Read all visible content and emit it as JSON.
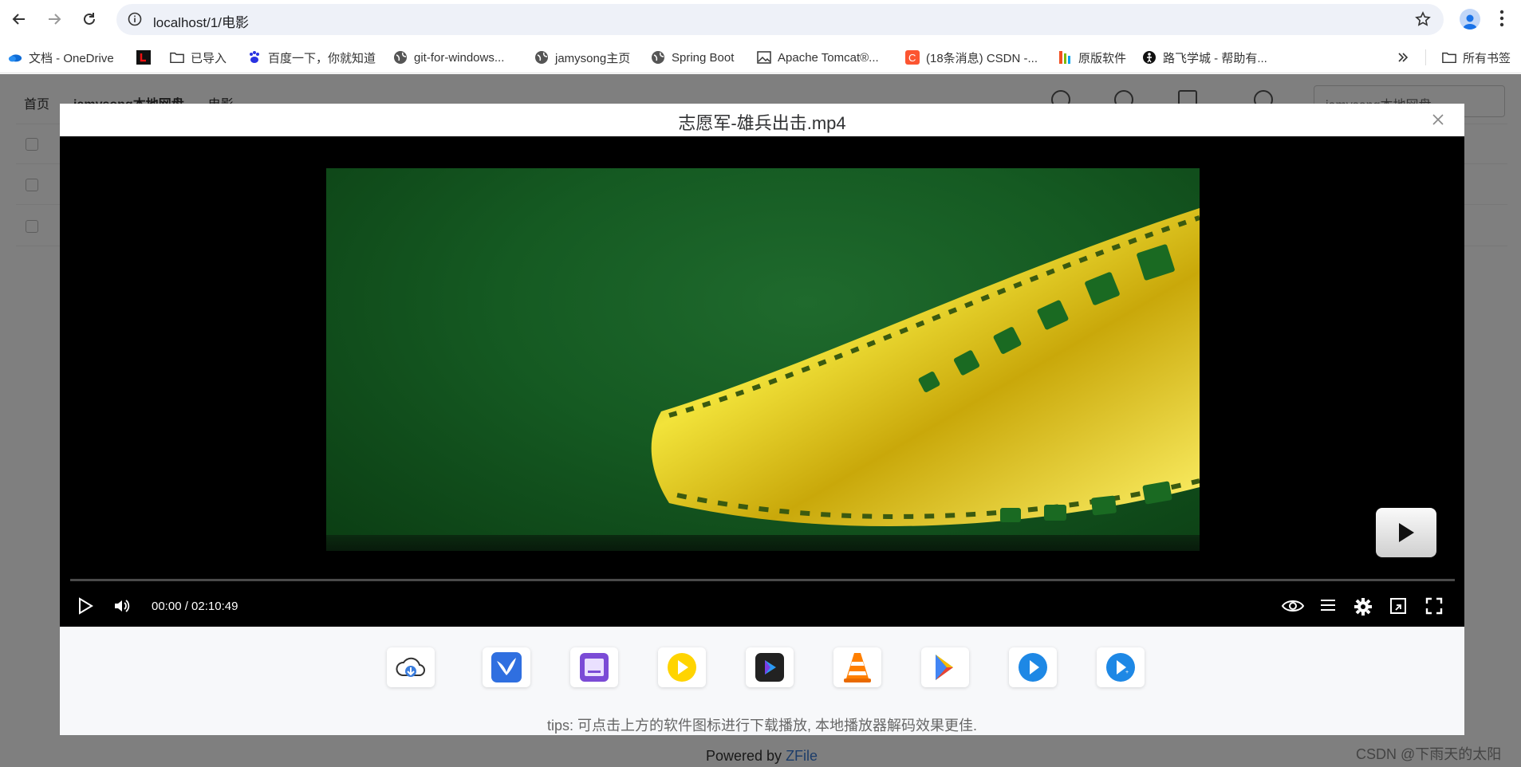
{
  "browser": {
    "url": "localhost/1/电影",
    "bookmarks": [
      {
        "label": "文档 - OneDrive",
        "icon": "onedrive-icon"
      },
      {
        "label": "",
        "icon": "l-logo-icon"
      },
      {
        "label": "已导入",
        "icon": "folder-icon"
      },
      {
        "label": "百度一下，你就知道",
        "icon": "baidu-icon"
      },
      {
        "label": "git-for-windows...",
        "icon": "globe-icon"
      },
      {
        "label": "jamysong主页",
        "icon": "globe-icon"
      },
      {
        "label": "Spring Boot",
        "icon": "globe-icon"
      },
      {
        "label": "Apache Tomcat®...",
        "icon": "image-icon"
      },
      {
        "label": "(18条消息) CSDN -...",
        "icon": "csdn-icon"
      },
      {
        "label": "原版软件",
        "icon": "ms-icon"
      },
      {
        "label": "路飞学城 - 帮助有...",
        "icon": "runner-icon"
      }
    ],
    "all_bookmarks_label": "所有书签"
  },
  "page": {
    "breadcrumbs": [
      "首页",
      "jamysong本地网盘",
      "电影"
    ],
    "storage_select": "jamysong本地网盘",
    "powered_by_prefix": "Powered by ",
    "powered_by_brand": "ZFile"
  },
  "modal": {
    "title": "志愿军-雄兵出击.mp4",
    "player": {
      "time": "00:00 / 02:10:49",
      "progress": 0
    },
    "apps": [
      {
        "name": "cloud-download-icon",
        "color": "#3b7ddd"
      },
      {
        "name": "xunlei-bird-icon",
        "color": "#2f6fe0"
      },
      {
        "name": "potplayer-box-icon",
        "color": "#7b4bd6"
      },
      {
        "name": "yellow-play-icon",
        "color": "#ffd400"
      },
      {
        "name": "dark-player-icon",
        "color": "#333333"
      },
      {
        "name": "vlc-cone-icon",
        "color": "#ff7f00"
      },
      {
        "name": "playstore-icon",
        "color": "#34a853"
      },
      {
        "name": "blue-play-icon",
        "color": "#1e88e5"
      },
      {
        "name": "blue-play-plus-icon",
        "color": "#1e88e5"
      }
    ],
    "tips": "tips: 可点击上方的软件图标进行下载播放, 本地播放器解码效果更佳."
  },
  "watermark": "CSDN @下雨天的太阳"
}
